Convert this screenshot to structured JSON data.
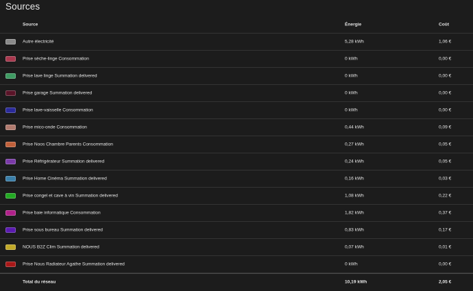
{
  "card": {
    "title": "Sources"
  },
  "table": {
    "headers": {
      "source": "Source",
      "energy": "Énergie",
      "cost": "Coût"
    },
    "rows": [
      {
        "color": "#8a8a8a",
        "source": "Autre électricité",
        "energy": "5,28 kWh",
        "cost": "1,06 €"
      },
      {
        "color": "#a8384e",
        "source": "Prise sèche-linge Consommation",
        "energy": "0 kWh",
        "cost": "0,00 €"
      },
      {
        "color": "#3e9a62",
        "source": "Prise lave linge Summation delivered",
        "energy": "0 kWh",
        "cost": "0,00 €"
      },
      {
        "color": "#5a1428",
        "source": "Prise garage Summation delivered",
        "energy": "0 kWh",
        "cost": "0,00 €"
      },
      {
        "color": "#2a2a9a",
        "source": "Prise lave-vaisselle Consommation",
        "energy": "0 kWh",
        "cost": "0,00 €"
      },
      {
        "color": "#b07a6e",
        "source": "Prise mico-onde Consommation",
        "energy": "0,44 kWh",
        "cost": "0,09 €"
      },
      {
        "color": "#c0603a",
        "source": "Prise Noos Chambre Parents Consommation",
        "energy": "0,27 kWh",
        "cost": "0,05 €"
      },
      {
        "color": "#7a3aa8",
        "source": "Prise Réfrigérateur Summation delivered",
        "energy": "0,24 kWh",
        "cost": "0,05 €"
      },
      {
        "color": "#3a7ea8",
        "source": "Prise Home Cinéma Summation delivered",
        "energy": "0,16 kWh",
        "cost": "0,03 €"
      },
      {
        "color": "#22a822",
        "source": "Prise congel et cave à vin Summation delivered",
        "energy": "1,08 kWh",
        "cost": "0,22 €"
      },
      {
        "color": "#b0208a",
        "source": "Prise baie informatique Consommation",
        "energy": "1,82 kWh",
        "cost": "0,37 €"
      },
      {
        "color": "#5a1ab0",
        "source": "Prise sous bureau Summation delivered",
        "energy": "0,83 kWh",
        "cost": "0,17 €"
      },
      {
        "color": "#c0a828",
        "source": "NOUS B2Z Clim Summation delivered",
        "energy": "0,07 kWh",
        "cost": "0,01 €"
      },
      {
        "color": "#a81818",
        "source": "Prise Nous Radiateur Agathe Summation delivered",
        "energy": "0 kWh",
        "cost": "0,00 €"
      }
    ],
    "total": {
      "source": "Total du réseau",
      "energy": "10,19 kWh",
      "cost": "2,05 €"
    }
  }
}
